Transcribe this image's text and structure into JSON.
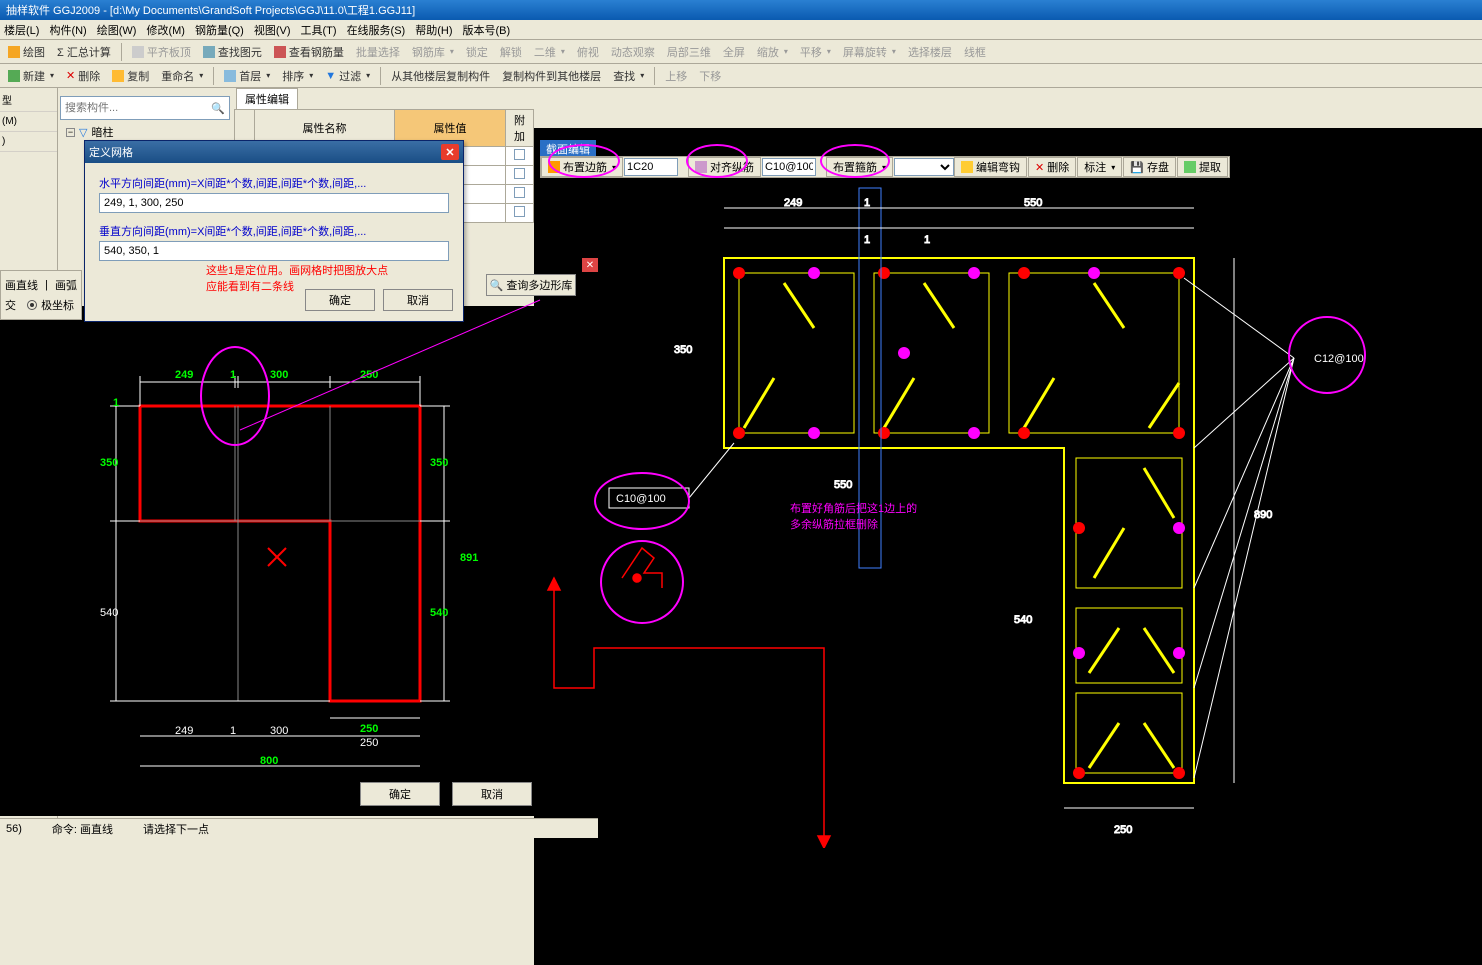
{
  "title": "抽样软件 GGJ2009 - [d:\\My Documents\\GrandSoft Projects\\GGJ\\11.0\\工程1.GGJ11]",
  "menu": [
    "楼层(L)",
    "构件(N)",
    "绘图(W)",
    "修改(M)",
    "钢筋量(Q)",
    "视图(V)",
    "工具(T)",
    "在线服务(S)",
    "帮助(H)",
    "版本号(B)"
  ],
  "tb1": {
    "draw": "绘图",
    "sum": "Σ 汇总计算",
    "flat": "平齐板顶",
    "findg": "查找图元",
    "viewrebar": "查看钢筋量",
    "batch": "批量选择",
    "rebarlib": "钢筋库",
    "lock": "锁定",
    "unlock": "解锁",
    "dim2": "二维",
    "persp": "俯视",
    "dyn": "动态观察",
    "local3d": "局部三维",
    "full": "全屏",
    "zoom": "缩放",
    "pan": "平移",
    "screenrot": "屏幕旋转",
    "selfloor": "选择楼层",
    "wireframe": "线框"
  },
  "tb2": {
    "new": "新建",
    "del": "删除",
    "copy": "复制",
    "rename": "重命名",
    "floor": "首层",
    "sort": "排序",
    "filter": "过滤",
    "copyfrom": "从其他楼层复制构件",
    "copyto": "复制构件到其他楼层",
    "find": "查找",
    "up": "上移",
    "down": "下移"
  },
  "search_ph": "搜索构件...",
  "tree_root": "暗柱",
  "prop": {
    "tab": "属性编辑",
    "col_name": "属性名称",
    "col_val": "属性值",
    "col_add": "附加"
  },
  "dialog": {
    "title": "定义网格",
    "hlabel": "水平方向间距(mm)=X间距*个数,间距,间距*个数,间距,...",
    "hval": "249, 1, 300, 250",
    "vlabel": "垂直方向间距(mm)=X间距*个数,间距,间距*个数,间距,...",
    "vval": "540, 350, 1",
    "ok": "确定",
    "cancel": "取消"
  },
  "anno1": "这些1是定位用。画网格时把图放大点",
  "anno2": "应能看到有二条线",
  "anno3": "布置好角筋后把这1边上的",
  "anno4": "多余纵筋拉框删除",
  "query_btn": "查询多边形库",
  "draw_modes": {
    "line": "画直线",
    "arc": "画弧",
    "ortho": "交",
    "polar": "极坐标"
  },
  "bottom": {
    "ok": "确定",
    "cancel": "取消"
  },
  "status": {
    "cmd_label": "命令:",
    "cmd": "画直线",
    "prompt": "请选择下一点",
    "left": "56)"
  },
  "sec": {
    "title": "截面编辑",
    "edge": "布置边筋",
    "edge_val": "1C20",
    "align": "对齐纵筋",
    "align_val": "C10@100",
    "stirrup": "布置箍筋",
    "edit_hook": "编辑弯钩",
    "del": "删除",
    "label": "标注",
    "save": "存盘",
    "extract": "提取"
  },
  "dims_left": {
    "h": [
      "249",
      "1",
      "300",
      "250"
    ],
    "hb": [
      "249",
      "1",
      "300",
      "250"
    ],
    "v_left_top": "1",
    "v_left": "350",
    "v_left2": "540",
    "v_right": "350",
    "v_right2": "891",
    "v_right3": "540",
    "total_w": "800",
    "total_w2": "250"
  },
  "dims_right": {
    "top": [
      "249",
      "1",
      "550"
    ],
    "mid": [
      "1",
      "1"
    ],
    "v350": "350",
    "v890": "890",
    "v540": "540",
    "b250": "250",
    "b550": "550",
    "c10": "C10@100",
    "c12": "C12@100"
  }
}
